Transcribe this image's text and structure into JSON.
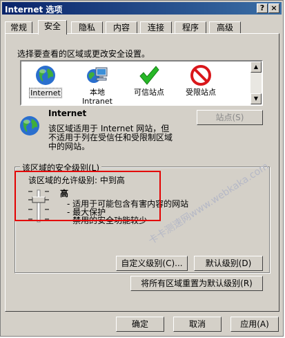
{
  "window": {
    "title": "Internet 选项",
    "help_btn": "?",
    "close_btn": "×"
  },
  "tabs": [
    "常规",
    "安全",
    "隐私",
    "内容",
    "连接",
    "程序",
    "高级"
  ],
  "instruction": "选择要查看的区域或更改安全设置。",
  "zones": [
    {
      "label": "Internet",
      "label2": ""
    },
    {
      "label": "本地",
      "label2": "Intranet"
    },
    {
      "label": "可信站点",
      "label2": ""
    },
    {
      "label": "受限站点",
      "label2": ""
    }
  ],
  "zone_info": {
    "name": "Internet",
    "desc": [
      "该区域适用于 Internet 网站，但",
      "不适用于列在受信任和受限制区域",
      "中的网站。"
    ],
    "sites_btn": "站点(S)"
  },
  "security_level": {
    "group_title": "该区域的安全级别(L)",
    "allowed": "该区域的允许级别: 中到高",
    "level": "高",
    "bullets": [
      "- 适用于可能包含有害内容的网站",
      "- 最大保护",
      "- 禁用的安全功能较少"
    ],
    "slider_level": 1
  },
  "buttons": {
    "custom": "自定义级别(C)...",
    "default": "默认级别(D)",
    "reset_all": "将所有区域重置为默认级别(R)",
    "ok": "确定",
    "cancel": "取消",
    "apply": "应用(A)"
  },
  "watermark": "卡卡测速网www.webkaka.com",
  "colors": {
    "highlight": "#e30000",
    "title_start": "#0a246a",
    "title_end": "#3a6ea5"
  }
}
